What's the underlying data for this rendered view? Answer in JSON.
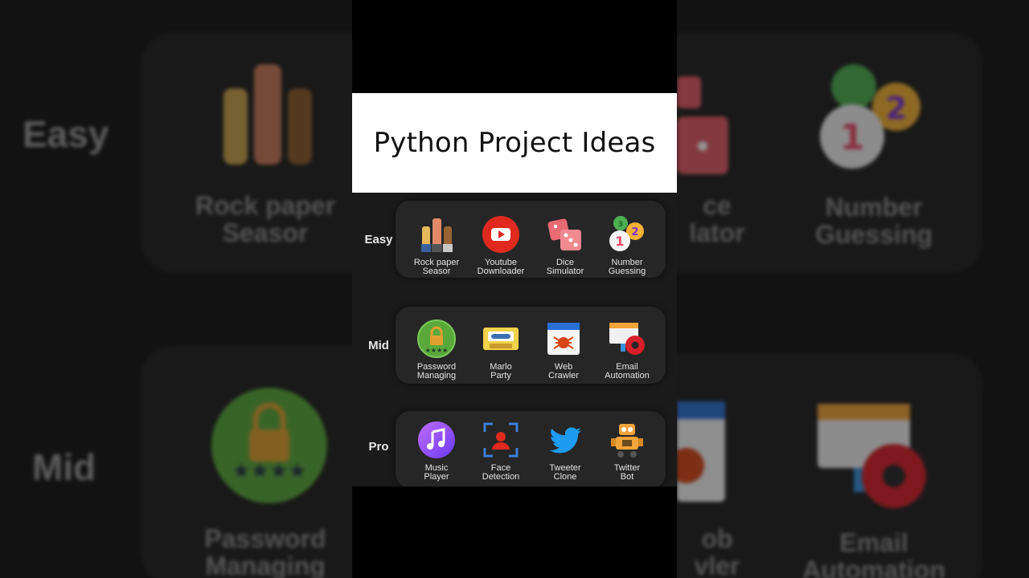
{
  "title": "Python Project Ideas",
  "levels": [
    {
      "label": "Easy",
      "items": [
        {
          "icon": "raised-hands-icon",
          "line1": "Rock paper",
          "line2": "Seasor"
        },
        {
          "icon": "youtube-icon",
          "line1": "Youtube",
          "line2": "Downloader"
        },
        {
          "icon": "dice-icon",
          "line1": "Dice",
          "line2": "Simulator"
        },
        {
          "icon": "number-bubbles-icon",
          "line1": "Number",
          "line2": "Guessing"
        }
      ]
    },
    {
      "label": "Mid",
      "items": [
        {
          "icon": "password-lock-icon",
          "line1": "Password",
          "line2": "Managing"
        },
        {
          "icon": "cassette-icon",
          "line1": "Marlo",
          "line2": "Party"
        },
        {
          "icon": "spider-web-icon",
          "line1": "Web",
          "line2": "Crawler"
        },
        {
          "icon": "email-gear-icon",
          "line1": "Email",
          "line2": "Automation"
        }
      ]
    },
    {
      "label": "Pro",
      "items": [
        {
          "icon": "music-note-icon",
          "line1": "Music",
          "line2": "Player"
        },
        {
          "icon": "face-scan-icon",
          "line1": "Face",
          "line2": "Detection"
        },
        {
          "icon": "twitter-bird-icon",
          "line1": "Tweeter",
          "line2": "Clone"
        },
        {
          "icon": "robot-icon",
          "line1": "Twitter",
          "line2": "Bot"
        }
      ]
    }
  ],
  "colors": {
    "youtube": "#e02a1f",
    "dice": "#e86a72",
    "twitter": "#1d9bf0",
    "music": "#9b4dff",
    "robot": "#f2a33a"
  }
}
